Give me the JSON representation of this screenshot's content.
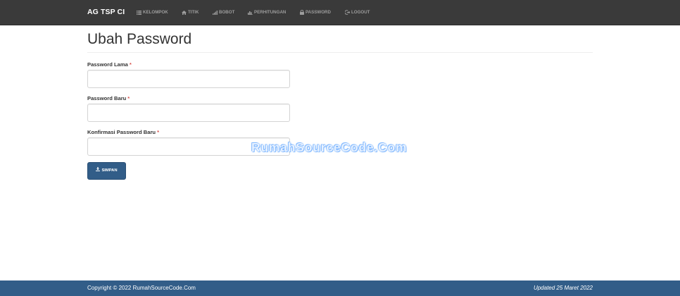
{
  "navbar": {
    "brand": "AG TSP CI",
    "items": [
      {
        "label": "KELOMPOK",
        "icon": "list-icon"
      },
      {
        "label": "TITIK",
        "icon": "home-icon"
      },
      {
        "label": "BOBOT",
        "icon": "signal-icon"
      },
      {
        "label": "PERHITUNGAN",
        "icon": "stats-icon"
      },
      {
        "label": "PASSWORD",
        "icon": "lock-icon"
      },
      {
        "label": "LOGOUT",
        "icon": "logout-icon"
      }
    ]
  },
  "page": {
    "title": "Ubah Password"
  },
  "form": {
    "fields": [
      {
        "label": "Password Lama",
        "required_mark": "*",
        "value": "",
        "placeholder": ""
      },
      {
        "label": "Password Baru",
        "required_mark": "*",
        "value": "",
        "placeholder": ""
      },
      {
        "label": "Konfirmasi Password Baru",
        "required_mark": "*",
        "value": "",
        "placeholder": ""
      }
    ],
    "submit_label": "SIMPAN",
    "submit_icon": "download-icon"
  },
  "watermark": "RumahSourceCode.Com",
  "footer": {
    "copyright": "Copyright © 2022 RumahSourceCode.Com",
    "updated": "Updated 25 Maret 2022"
  },
  "colors": {
    "navbar_bg": "#3a3a3a",
    "primary": "#325d88",
    "required": "#d9534f"
  }
}
